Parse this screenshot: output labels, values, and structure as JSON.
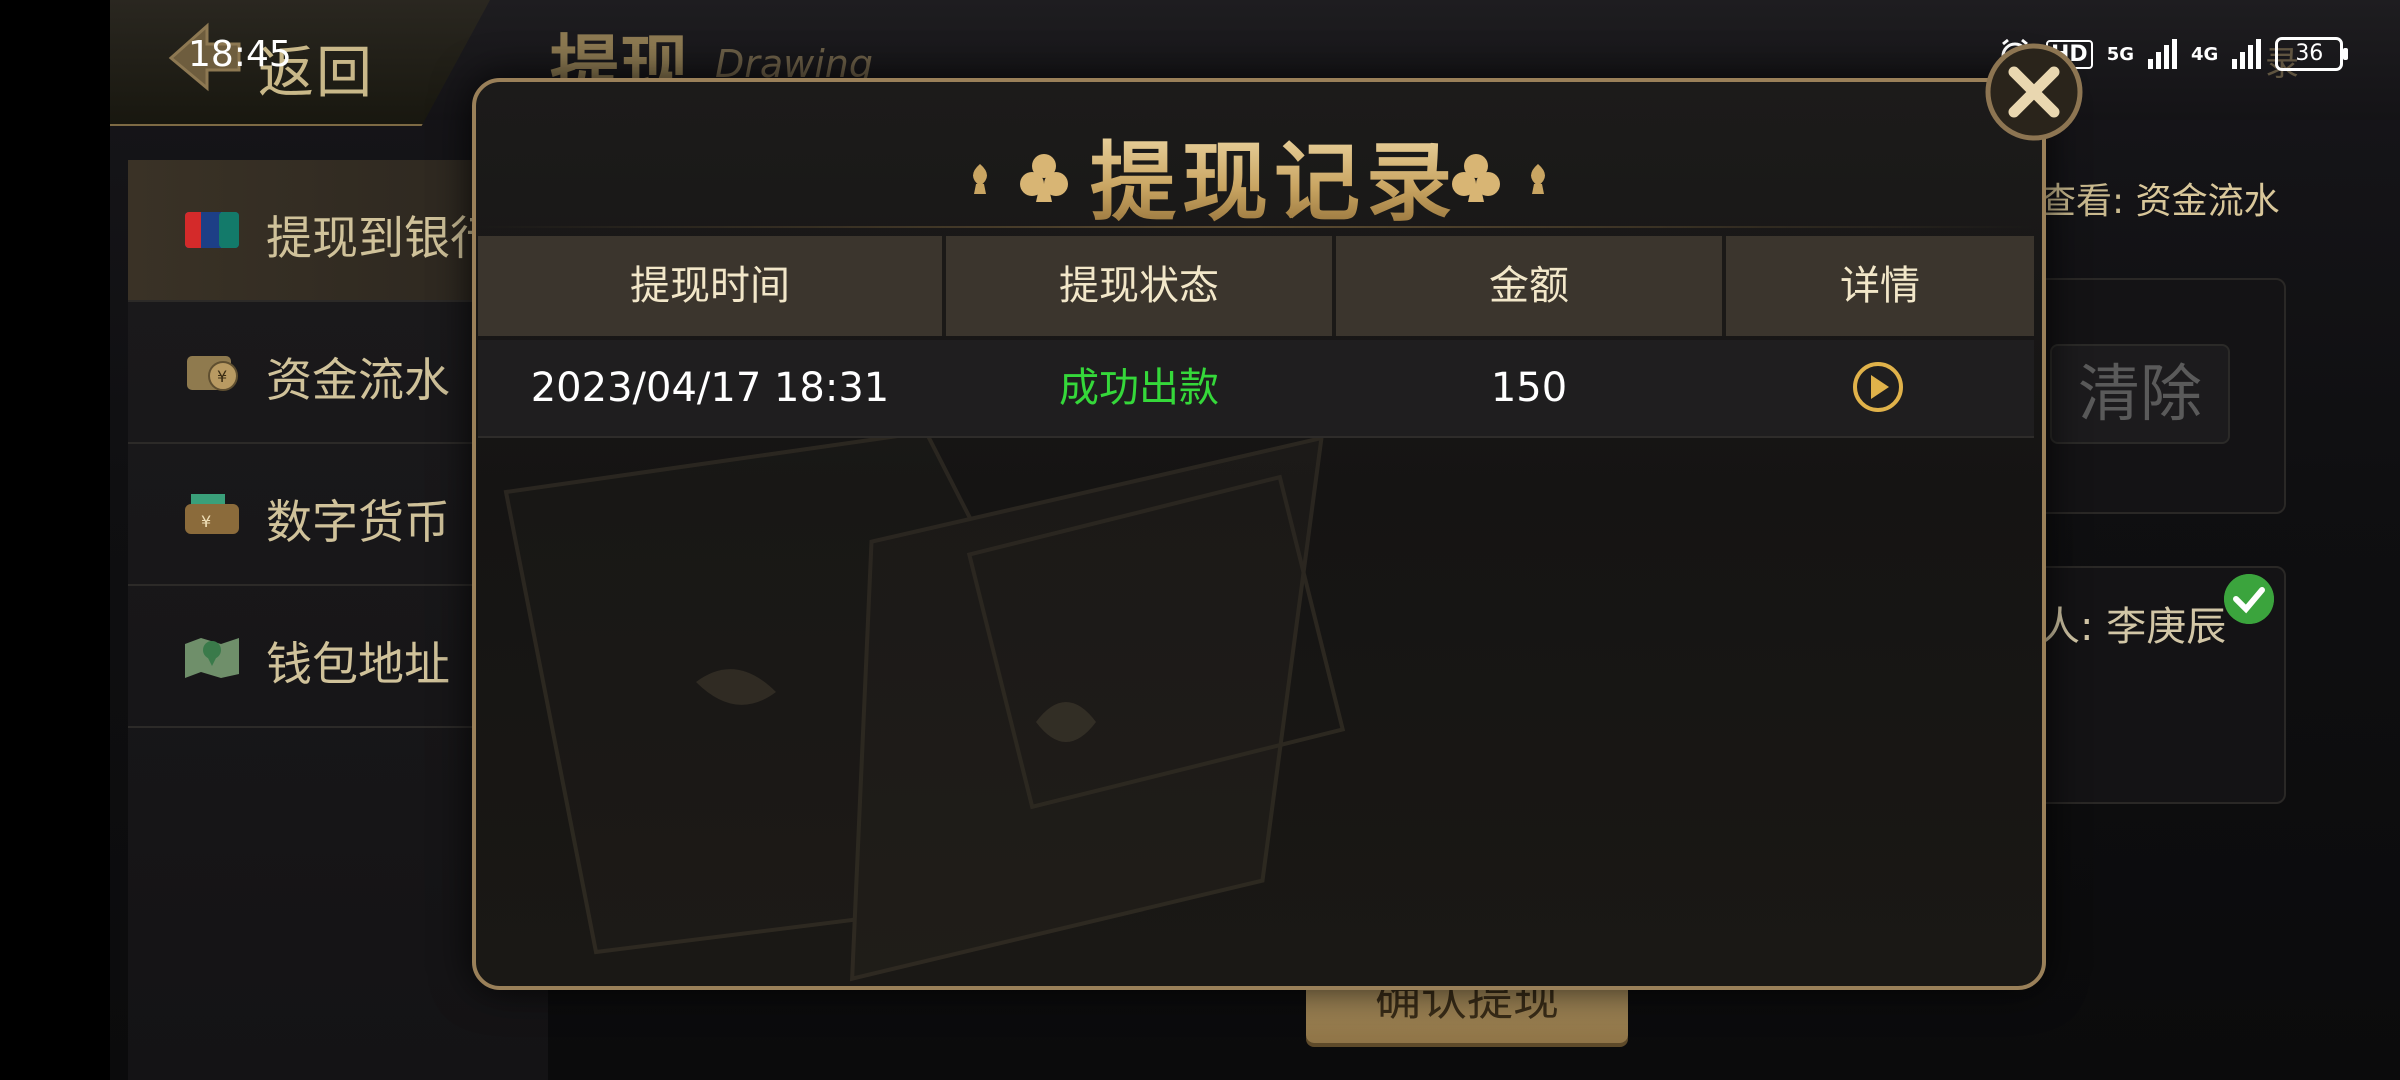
{
  "status_bar": {
    "time": "18:45",
    "hd": "HD",
    "net5g": "5G",
    "net4g": "4G",
    "battery": "36"
  },
  "header": {
    "back_label": "返回",
    "title": "提现",
    "subtitle": "Drawing",
    "record_tab": "录"
  },
  "sidebar": {
    "items": [
      {
        "label": "提现到银行"
      },
      {
        "label": "资金流水"
      },
      {
        "label": "数字货币"
      },
      {
        "label": "钱包地址"
      }
    ]
  },
  "main": {
    "hint_prefix": "查看:",
    "hint_link": "资金流水",
    "clear_label": "清除",
    "payee": "人: 李庚辰",
    "confirm_label": "确认提现"
  },
  "modal": {
    "title": "提现记录",
    "columns": [
      "提现时间",
      "提现状态",
      "金额",
      "详情"
    ],
    "rows": [
      {
        "time": "2023/04/17 18:31",
        "status": "成功出款",
        "amount": "150"
      }
    ]
  },
  "colors": {
    "accent_gold": "#c9a562",
    "success_green": "#35d83a",
    "modal_border": "#9a8059"
  }
}
